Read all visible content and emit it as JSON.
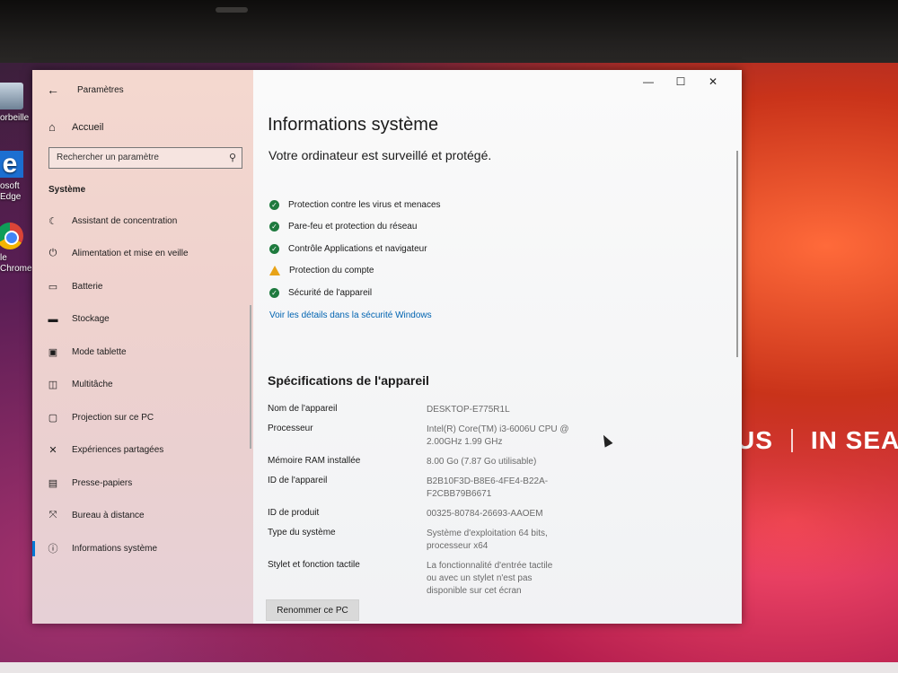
{
  "desktop": {
    "icons": [
      {
        "label": "orbeille",
        "icon": "recycle-bin-icon"
      },
      {
        "label": "osoft Edge",
        "icon": "edge-icon"
      },
      {
        "label": "le Chrome",
        "icon": "chrome-icon"
      }
    ],
    "wallpaper_brand": "IN SEARC",
    "wallpaper_logo": "US"
  },
  "sidebar": {
    "window_title": "Paramètres",
    "home_label": "Accueil",
    "search_placeholder": "Rechercher un paramètre",
    "section_label": "Système",
    "items": [
      {
        "label": "Assistant de concentration",
        "icon": "moon-icon"
      },
      {
        "label": "Alimentation et mise en veille",
        "icon": "power-icon"
      },
      {
        "label": "Batterie",
        "icon": "battery-icon"
      },
      {
        "label": "Stockage",
        "icon": "storage-icon"
      },
      {
        "label": "Mode tablette",
        "icon": "tablet-icon"
      },
      {
        "label": "Multitâche",
        "icon": "multitask-icon"
      },
      {
        "label": "Projection sur ce PC",
        "icon": "projection-icon"
      },
      {
        "label": "Expériences partagées",
        "icon": "share-icon"
      },
      {
        "label": "Presse-papiers",
        "icon": "clipboard-icon"
      },
      {
        "label": "Bureau à distance",
        "icon": "remote-desktop-icon"
      },
      {
        "label": "Informations système",
        "icon": "info-icon",
        "active": true
      }
    ]
  },
  "main": {
    "title": "Informations système",
    "protection_title": "Votre ordinateur est surveillé et protégé.",
    "protection_items": [
      {
        "label": "Protection contre les virus et menaces",
        "status": "ok"
      },
      {
        "label": "Pare-feu et protection du réseau",
        "status": "ok"
      },
      {
        "label": "Contrôle Applications et navigateur",
        "status": "ok"
      },
      {
        "label": "Protection du compte",
        "status": "warning"
      },
      {
        "label": "Sécurité de l'appareil",
        "status": "ok"
      }
    ],
    "details_link": "Voir les détails dans la sécurité Windows",
    "specs_title": "Spécifications de l'appareil",
    "specs": [
      {
        "label": "Nom de l'appareil",
        "value": "DESKTOP-E775R1L"
      },
      {
        "label": "Processeur",
        "value": "Intel(R) Core(TM) i3-6006U CPU @\n2.00GHz   1.99 GHz"
      },
      {
        "label": "Mémoire RAM installée",
        "value": "8.00 Go (7.87 Go utilisable)"
      },
      {
        "label": "ID de l'appareil",
        "value": "B2B10F3D-B8E6-4FE4-B22A-\nF2CBB79B6671"
      },
      {
        "label": "ID de produit",
        "value": "00325-80784-26693-AAOEM"
      },
      {
        "label": "Type du système",
        "value": "Système d'exploitation 64 bits,\nprocesseur x64"
      },
      {
        "label": "Stylet et fonction tactile",
        "value": "La fonctionnalité d'entrée tactile\nou avec un stylet n'est pas\ndisponible sur cet écran"
      }
    ],
    "rename_button": "Renommer ce PC"
  },
  "colors": {
    "ok": "#1e7a3e",
    "warning": "#e8a317",
    "link": "#0063b1",
    "accent": "#0078d4"
  }
}
